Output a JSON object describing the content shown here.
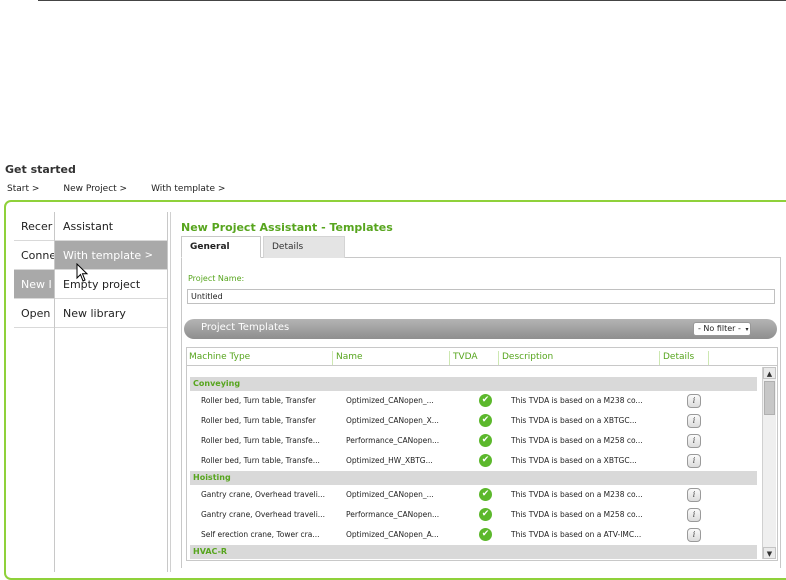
{
  "header": {
    "title": "Get started",
    "breadcrumbs": [
      "Start >",
      "New Project >",
      "With template >"
    ]
  },
  "nav_col1": [
    {
      "label": "Recer"
    },
    {
      "label": "Conne"
    },
    {
      "label": "New I"
    },
    {
      "label": "Open"
    }
  ],
  "nav_col2": [
    {
      "label": "Assistant"
    },
    {
      "label": "With template",
      "arrow": ">"
    },
    {
      "label": "Empty project"
    },
    {
      "label": "New library"
    }
  ],
  "panel": {
    "title": "New Project Assistant - Templates",
    "tabs": [
      "General",
      "Details"
    ],
    "project_name_label": "Project Name:",
    "project_name_value": "Untitled",
    "templates_title": "Project Templates",
    "filter_value": "- No filter -"
  },
  "grid": {
    "columns": [
      "Machine Type",
      "Name",
      "TVDA",
      "Description",
      "Details"
    ],
    "groups": [
      {
        "name": "Conveying",
        "rows": [
          {
            "type": "Roller bed, Turn table, Transfer",
            "name": "Optimized_CANopen_...",
            "tvda": "✔",
            "desc": "This TVDA is based on a M238 co...",
            "info": "i"
          },
          {
            "type": "Roller bed, Turn table, Transfer",
            "name": "Optimized_CANopen_X...",
            "tvda": "✔",
            "desc": "This TVDA is based on a XBTGC...",
            "info": "i"
          },
          {
            "type": "Roller bed, Turn table, Transfe...",
            "name": "Performance_CANopen...",
            "tvda": "✔",
            "desc": "This TVDA is based on a M258 co...",
            "info": "i"
          },
          {
            "type": "Roller bed, Turn table, Transfe...",
            "name": "Optimized_HW_XBTG...",
            "tvda": "✔",
            "desc": "This TVDA is based on a XBTGC...",
            "info": "i"
          }
        ]
      },
      {
        "name": "Hoisting",
        "rows": [
          {
            "type": "Gantry crane, Overhead traveli...",
            "name": "Optimized_CANopen_...",
            "tvda": "✔",
            "desc": "This TVDA is based on a M238 co...",
            "info": "i"
          },
          {
            "type": "Gantry crane, Overhead traveli...",
            "name": "Performance_CANopen...",
            "tvda": "✔",
            "desc": "This TVDA is based on a M258 co...",
            "info": "i"
          },
          {
            "type": "Self erection crane, Tower cra...",
            "name": "Optimized_CANopen_A...",
            "tvda": "✔",
            "desc": "This TVDA is based on a ATV-IMC...",
            "info": "i"
          }
        ]
      },
      {
        "name": "HVAC-R",
        "rows": []
      }
    ]
  },
  "scrollbar": {
    "up": "▲",
    "down": "▼"
  }
}
